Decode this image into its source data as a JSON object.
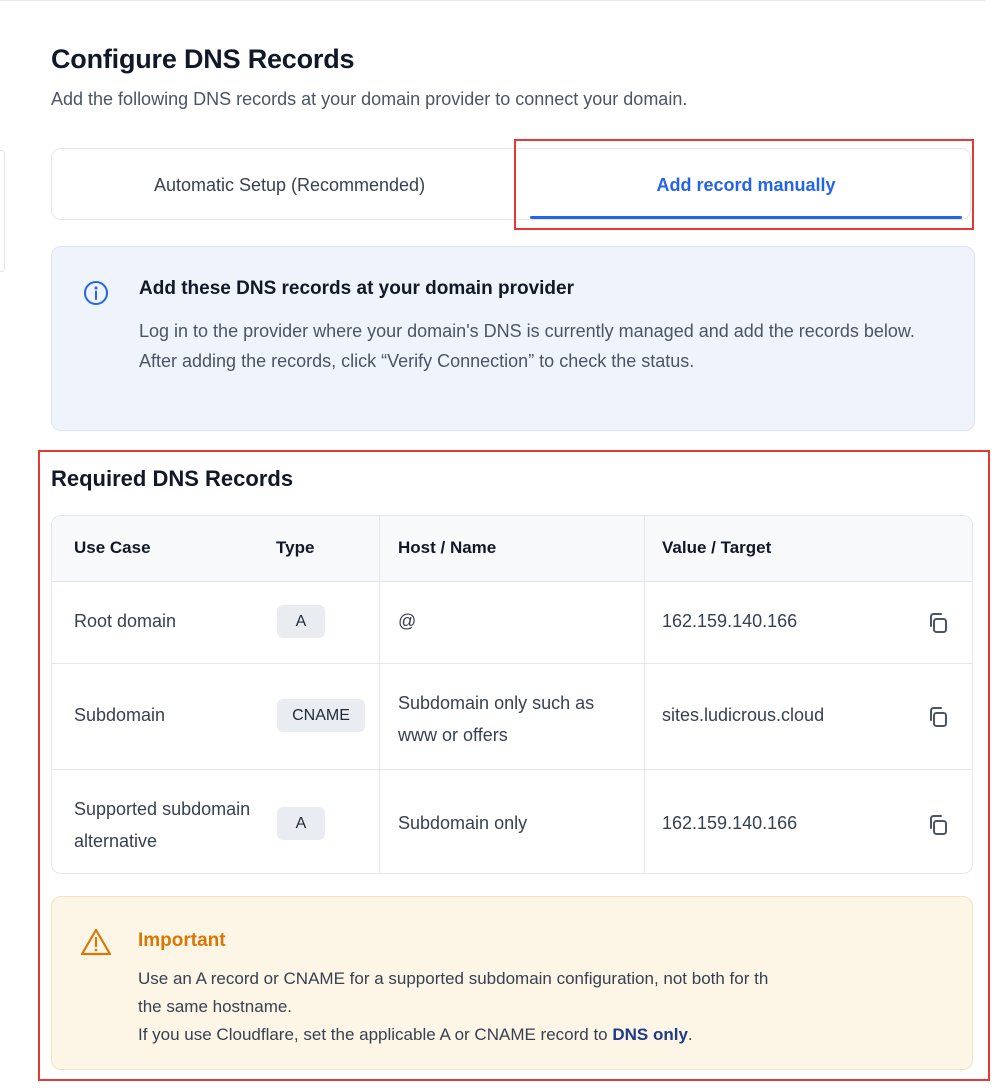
{
  "header": {
    "title": "Configure DNS Records",
    "subtitle": "Add the following DNS records at your domain provider to connect your domain."
  },
  "tabs": [
    {
      "label": "Automatic Setup (Recommended)",
      "active": false
    },
    {
      "label": "Add record manually",
      "active": true
    }
  ],
  "info": {
    "icon": "info-circle-icon",
    "title": "Add these DNS records at your domain provider",
    "body": "Log in to the provider where your domain's DNS is currently managed and add the records below. After adding the records, click “Verify Connection” to check the status."
  },
  "records": {
    "title": "Required DNS Records",
    "columns": [
      "Use Case",
      "Type",
      "Host / Name",
      "Value / Target"
    ],
    "rows": [
      {
        "use_case": "Root domain",
        "type": "A",
        "host": "@",
        "value": "162.159.140.166"
      },
      {
        "use_case": "Subdomain",
        "type": "CNAME",
        "host": "Subdomain only such as www or offers",
        "value": "sites.ludicrous.cloud"
      },
      {
        "use_case": "Supported subdomain alternative",
        "type": "A",
        "host": "Subdomain only",
        "value": "162.159.140.166"
      }
    ],
    "copy_icon": "copy-icon"
  },
  "important": {
    "icon": "warning-triangle-icon",
    "title": "Important",
    "line1": "Use an A record or CNAME for a supported subdomain configuration, not both for th",
    "line2": "the same hostname.",
    "line3_prefix": "If you use Cloudflare, set the applicable A or CNAME record to ",
    "line3_bold": "DNS only",
    "line3_suffix": "."
  },
  "colors": {
    "accent": "#2563eb",
    "highlight": "#e53935",
    "info_bg": "#eef3fc",
    "warning_bg": "#fdf5e6",
    "warning_text": "#d97706"
  }
}
